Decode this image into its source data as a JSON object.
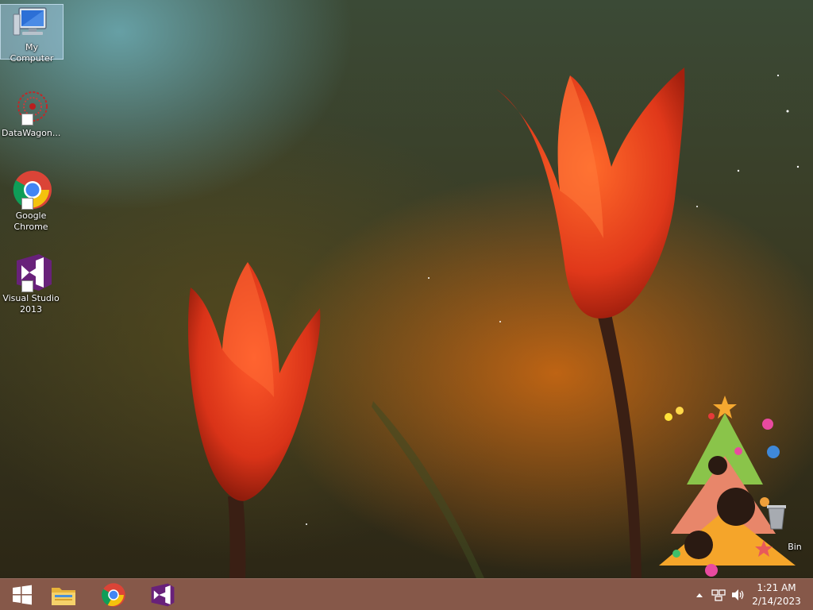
{
  "desktop": {
    "icons": [
      {
        "label": "My Computer",
        "selected": true
      },
      {
        "label": "DataWagon..."
      },
      {
        "label_line1": "Google",
        "label_line2": "Chrome"
      },
      {
        "label_line1": "Visual Studio",
        "label_line2": "2013"
      }
    ],
    "recycle_bin_label": "Bin"
  },
  "taskbar": {
    "pinned": [
      "windows-start-icon",
      "file-explorer-icon",
      "chrome-icon",
      "visual-studio-icon"
    ],
    "tray": {
      "icons": [
        "show-hidden-icons-arrow",
        "network-icon",
        "volume-icon"
      ]
    },
    "clock": {
      "time": "1:21 AM",
      "date": "2/14/2023"
    }
  }
}
